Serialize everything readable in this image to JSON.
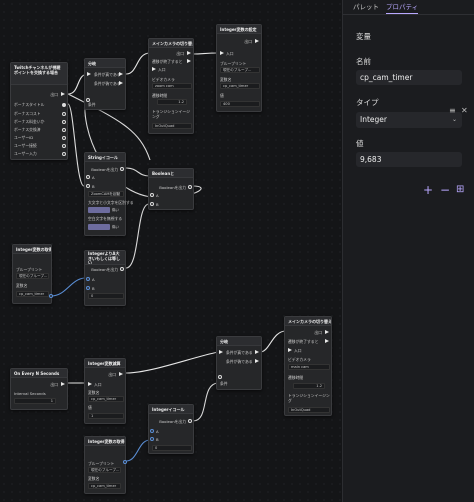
{
  "panel": {
    "tabs": [
      "パレット",
      "プロパティ"
    ],
    "section": "変量",
    "name_label": "名前",
    "name_value": "cp_cam_timer",
    "type_label": "タイプ",
    "type_value": "Integer",
    "value_label": "値",
    "value_value": "9,683",
    "icons": [
      "menu-icon",
      "close-icon",
      "plus-icon",
      "minus-icon",
      "tree-icon"
    ]
  },
  "nodes": {
    "twitch": {
      "title": "Twitchチャンネルが視聴ポイントを交換する場合",
      "exec": "出口",
      "rows": [
        "ボーナスタイトル",
        "ボーナスコスト",
        "ボーナス料金いか",
        "ボーナス交換済",
        "ユーザーID",
        "ユーザー接続",
        "ユーザー入力"
      ]
    },
    "branch1": {
      "title": "分岐",
      "true": "条件が真である",
      "false": "条件が偽である",
      "cond": "条件"
    },
    "camsw1": {
      "title": "メインカメラの切り替え",
      "exec": "出口",
      "done": "遷移が終了すると",
      "exec2": "入口",
      "cam_label": "ビデオカメラ",
      "cam": "zoom cam",
      "dur_label": "遷移時間",
      "dur": "1.2",
      "trans_label": "トランジションイージング",
      "trans": "InOutQuad"
    },
    "intset1": {
      "title": "Integer変数の設定",
      "exec": "出口",
      "exec2": "入口",
      "bp_label": "ブループリント",
      "bp": "現在のブループ...",
      "var_label": "変数名",
      "var": "cp_cam_timer",
      "val_label": "値",
      "val": "400"
    },
    "streq": {
      "title": "Stringイコール",
      "a": "A",
      "b": "B",
      "cs_label": "大文字と小文字を区別する",
      "cs": "偽い",
      "ws_label": "空白文字を無視する",
      "ws": "偽い",
      "a_val": "ZoomCAMを起動",
      "out": "Booleanを出力"
    },
    "boolc": {
      "title": "Booleanと",
      "a": "A",
      "b": "B",
      "out": "Booleanを出力"
    },
    "intget1": {
      "title": "Integer変数の取得",
      "bp_label": "ブループリント",
      "bp": "現在のブループ...",
      "var_label": "変数名",
      "var": "cp_cam_timer"
    },
    "intlt": {
      "title": "IntegerよりA大きいもしくは等しい",
      "a": "A",
      "b": "B",
      "b_val": "0",
      "out": "Booleanを出力"
    },
    "onevery": {
      "title": "On Every N Seconds",
      "exec": "出口",
      "sec_label": "Interval Seconds",
      "sec": "1"
    },
    "intsub": {
      "title": "Integer変数減算",
      "exec": "出口",
      "exec2": "入口",
      "var_label": "変数名",
      "var": "cp_cam_timer",
      "val_label": "値",
      "val": "1"
    },
    "inteq": {
      "title": "Integerイコール",
      "a": "A",
      "b": "B",
      "b_val": "0",
      "out": "Booleanを出力"
    },
    "intget2": {
      "title": "Integer変数の取得",
      "bp_label": "ブループリント",
      "bp": "現在のブループ...",
      "var_label": "変数名",
      "var": "cp_cam_timer"
    },
    "branch2": {
      "title": "分岐",
      "true": "条件が真である",
      "false": "条件が偽である",
      "cond": "条件"
    },
    "camsw2": {
      "title": "メインカメラの切り替え",
      "exec": "出口",
      "done": "遷移が終了すると",
      "exec2": "入口",
      "cam_label": "ビデオカメラ",
      "cam": "main cam",
      "dur_label": "遷移時間",
      "dur": "1.2",
      "trans_label": "トランジションイージング",
      "trans": "InOutQuad"
    }
  }
}
